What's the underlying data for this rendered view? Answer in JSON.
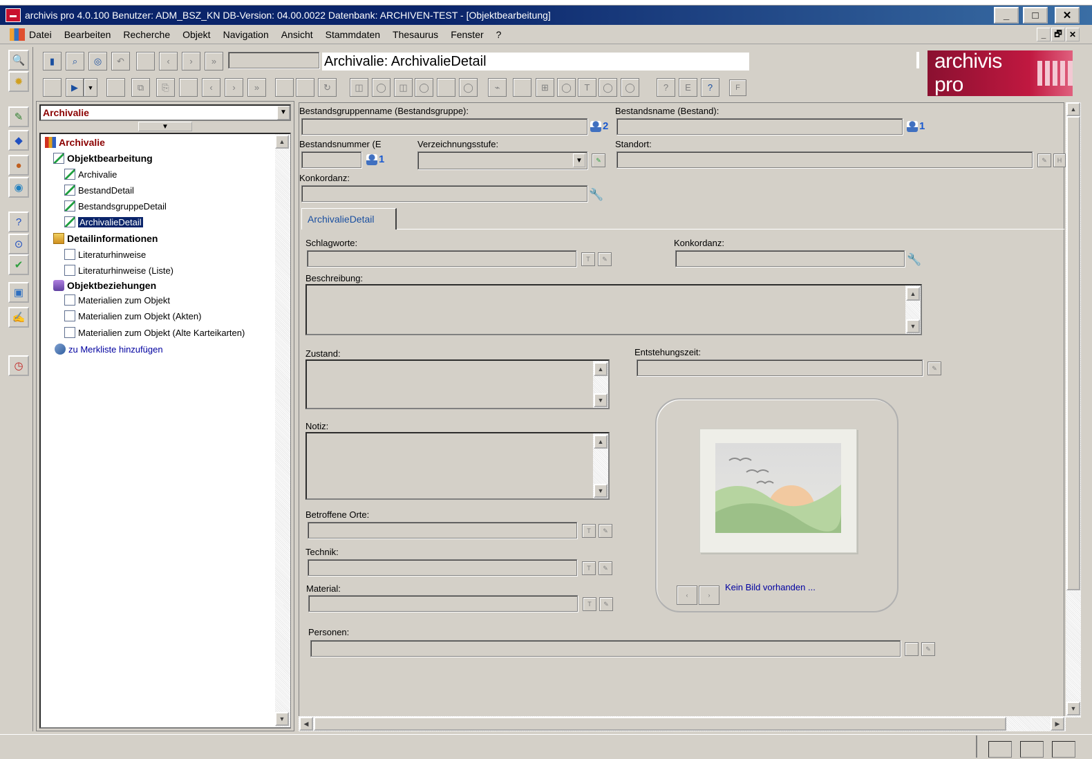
{
  "window": {
    "title": "archivis pro 4.0.100  Benutzer: ADM_BSZ_KN  DB-Version: 04.00.0022  Datenbank: ARCHIVEN-TEST - [Objektbearbeitung]",
    "minimize": "_",
    "maximize": "□",
    "close": "✕"
  },
  "menu": {
    "items": [
      "Datei",
      "Bearbeiten",
      "Recherche",
      "Objekt",
      "Navigation",
      "Ansicht",
      "Stammdaten",
      "Thesaurus",
      "Fenster",
      "?"
    ],
    "mdi_minimize": "_",
    "mdi_restore": "🗗",
    "mdi_close": "✕"
  },
  "toolbar": {
    "object_title": "Archivalie: ArchivalieDetail",
    "f_button": "F"
  },
  "logo": {
    "text": "archivis pro"
  },
  "nav": {
    "combo_value": "Archivalie",
    "tree": {
      "root": "Archivalie",
      "group1": "Objektbearbeitung",
      "group1_items": [
        "Archivalie",
        "BestandDetail",
        "BestandsgruppeDetail",
        "ArchivalieDetail"
      ],
      "group2": "Detailinformationen",
      "group2_items": [
        "Literaturhinweise",
        "Literaturhinweise (Liste)"
      ],
      "group3": "Objektbeziehungen",
      "group3_items": [
        "Materialien zum Objekt",
        "Materialien zum Objekt (Akten)",
        "Materialien zum Objekt (Alte Karteikarten)"
      ],
      "merkliste": "zu Merkliste hinzufügen"
    }
  },
  "form": {
    "bestandsgruppenname_label": "Bestandsgruppenname (Bestandsgruppe):",
    "bestandsgruppenname_count": "2",
    "bestandsname_label": "Bestandsname (Bestand):",
    "bestandsname_count": "1",
    "bestandsnummer_label": "Bestandsnummer (E",
    "bestandsnummer_count": "1",
    "verzeichnungsstufe_label": "Verzeichnungsstufe:",
    "standort_label": "Standort:",
    "konkordanz_label": "Konkordanz:",
    "tab_label": "ArchivalieDetail",
    "schlagworte_label": "Schlagworte:",
    "konkordanz2_label": "Konkordanz:",
    "beschreibung_label": "Beschreibung:",
    "zustand_label": "Zustand:",
    "entstehungszeit_label": "Entstehungszeit:",
    "notiz_label": "Notiz:",
    "betroffene_orte_label": "Betroffene Orte:",
    "technik_label": "Technik:",
    "material_label": "Material:",
    "personen_label": "Personen:",
    "kein_bild": "Kein Bild vorhanden ..."
  },
  "colors": {
    "titlebar": "#0a246a",
    "background": "#d4d0c8",
    "logo": "#c01840",
    "link": "#0000a0",
    "selection": "#0a246a"
  }
}
